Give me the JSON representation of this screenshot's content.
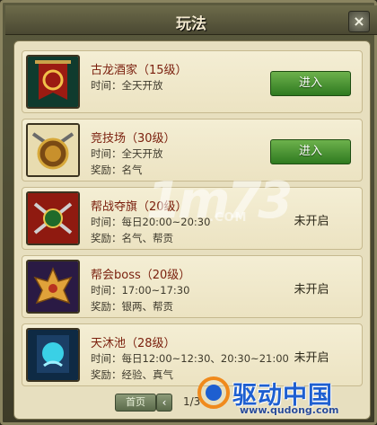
{
  "window": {
    "title": "玩法",
    "close_glyph": "×"
  },
  "activities": [
    {
      "name": "古龙酒家（15级）",
      "time": "时间：全天开放",
      "reward": "",
      "action": "进入",
      "icon": "tavern-banner-icon"
    },
    {
      "name": "竞技场（30级）",
      "time": "时间：全天开放",
      "reward": "奖励：名气",
      "action": "进入",
      "icon": "arena-shield-icon"
    },
    {
      "name": "帮战夺旗（20级）",
      "time": "时间：每日20:00~20:30",
      "reward": "奖励：名气、帮贡",
      "status": "未开启",
      "icon": "guild-flag-icon"
    },
    {
      "name": "帮会boss（20级）",
      "time": "时间：17:00~17:30",
      "reward": "奖励：银两、帮贡",
      "status": "未开启",
      "icon": "guild-boss-icon"
    },
    {
      "name": "天沐池（28级）",
      "time": "时间：每日12:00~12:30、20:30~21:00",
      "reward": "奖励：经验、真气",
      "status": "未开启",
      "icon": "spring-pool-icon"
    }
  ],
  "pager": {
    "first_label": "首页",
    "prev_glyph": "‹",
    "page": "1/3"
  },
  "watermarks": {
    "site1": "1m73",
    "site1_domain": ".COM",
    "site2_brand": "驱动中国",
    "site2_url": "www.qudong.com"
  },
  "colors": {
    "enter_button": "#3f8f2c",
    "name_text": "#7a1f0d",
    "panel_bg": "#e7dfbf"
  }
}
